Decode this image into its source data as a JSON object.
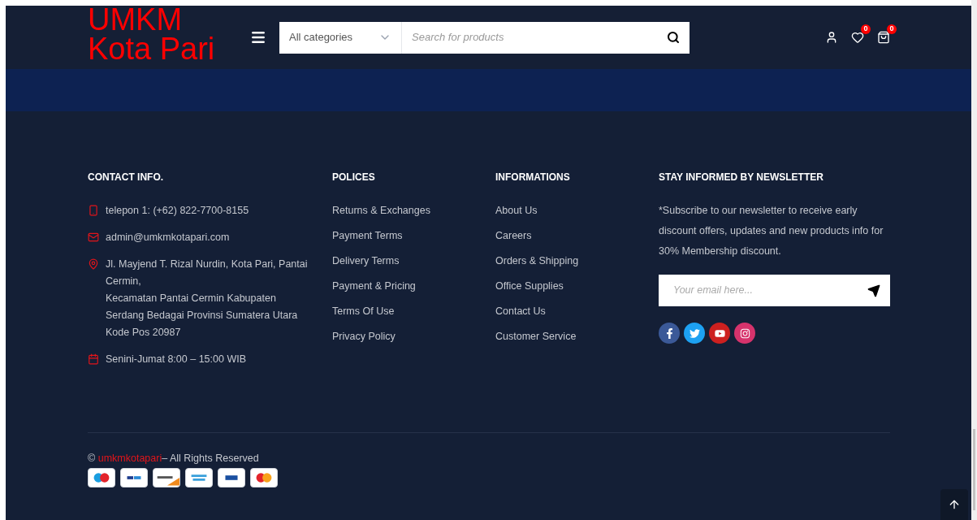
{
  "header": {
    "logo": [
      "UMKM",
      "Kota Pari"
    ],
    "category_select": "All categories",
    "search": {
      "placeholder": "Search for products"
    },
    "wishlist_count": "0",
    "cart_count": "0"
  },
  "footer": {
    "columns": [
      {
        "kind": "contact",
        "title": "CONTACT INFO.",
        "items": [
          {
            "text": "telepon 1: (+62) 822-7700-8155"
          },
          {
            "text": "admin@umkmkotapari.com"
          },
          {
            "lines": [
              "Jl. Mayjend T. Rizal Nurdin, Kota Pari, Pantai Cermin,",
              "Kecamatan Pantai Cermin Kabupaten Serdang Bedagai Provinsi Sumatera Utara Kode Pos 20987"
            ]
          },
          {
            "text": "Senini-Jumat 8:00 – 15:00 WIB"
          }
        ]
      },
      {
        "kind": "links",
        "title": "POLICES",
        "links": [
          "Returns & Exchanges",
          "Payment Terms",
          "Delivery Terms",
          "Payment & Pricing",
          "Terms Of Use",
          "Privacy Policy"
        ]
      },
      {
        "kind": "links",
        "title": "INFORMATIONS",
        "links": [
          "About Us",
          "Careers",
          "Orders & Shipping",
          "Office Supplies",
          "Contact Us",
          "Customer Service"
        ]
      },
      {
        "kind": "newsletter",
        "title": "STAY INFORMED BY NEWSLETTER",
        "text": "*Subscribe to our newsletter to receive early discount offers, updates and new products info for 30% Membership discount.",
        "email": {
          "placeholder": "Your email here..."
        },
        "social": [
          {
            "color": "#3b5998"
          },
          {
            "color": "#1da1f2"
          },
          {
            "color": "#cd201f"
          },
          {
            "color": "#d6336c"
          }
        ]
      }
    ],
    "copyright": {
      "prefix": "©",
      "brand": "umkmkotapari",
      "suffix": "– All Rights Reserved"
    }
  }
}
